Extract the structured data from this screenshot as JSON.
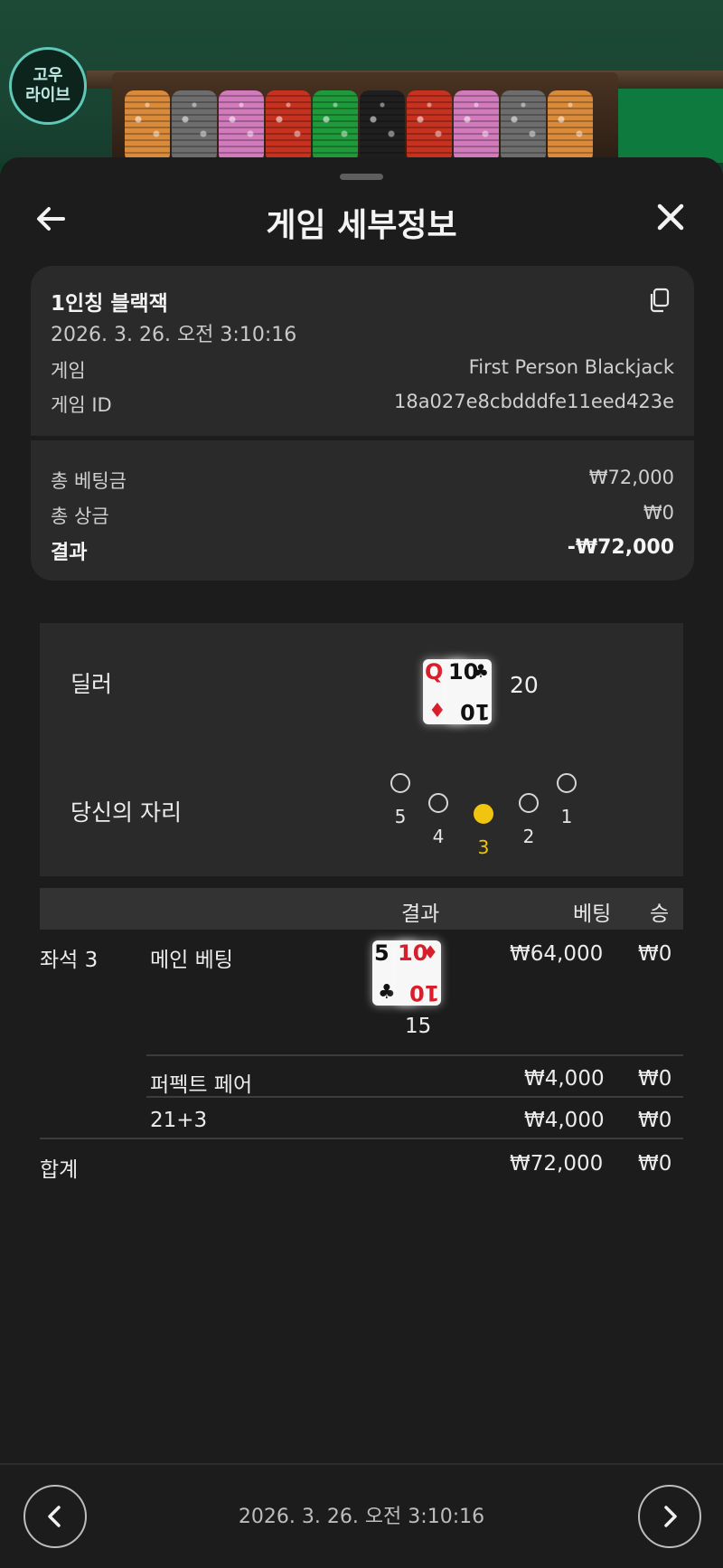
{
  "logo": {
    "line1": "고우",
    "line2": "라이브"
  },
  "header": {
    "title": "게임 세부정보",
    "back_icon": "arrow-left-icon",
    "close_icon": "close-icon"
  },
  "summary": {
    "game_name": "1인칭 블랙잭",
    "datetime": "2026. 3. 26. 오전 3:10:16",
    "game_label": "게임",
    "game_value": "First Person Blackjack",
    "game_id_label": "게임 ID",
    "game_id_value": "18a027e8cbdddfe11eed423e",
    "total_bet_label": "총 베팅금",
    "total_bet_value": "₩72,000",
    "total_prize_label": "총 상금",
    "total_prize_value": "₩0",
    "result_label": "결과",
    "result_value": "-₩72,000"
  },
  "dealer": {
    "label": "딜러",
    "cards": [
      {
        "rank": "Q",
        "suit": "♦"
      },
      {
        "rank": "10",
        "suit": "♣"
      }
    ],
    "total": "20"
  },
  "seats": {
    "label": "당신의 자리",
    "positions": [
      {
        "number": "5",
        "active": false
      },
      {
        "number": "4",
        "active": false
      },
      {
        "number": "3",
        "active": true
      },
      {
        "number": "2",
        "active": false
      },
      {
        "number": "1",
        "active": false
      }
    ]
  },
  "results_table": {
    "headers": {
      "result": "결과",
      "bet": "베팅",
      "win": "승"
    },
    "seat_label": "좌석 3",
    "rows": [
      {
        "name": "메인 베팅",
        "cards": [
          {
            "rank": "5",
            "suit": "♣"
          },
          {
            "rank": "10",
            "suit": "♦"
          }
        ],
        "hand_total": "15",
        "bet": "₩64,000",
        "win": "₩0"
      },
      {
        "name": "퍼펙트 페어",
        "bet": "₩4,000",
        "win": "₩0"
      },
      {
        "name": "21+3",
        "bet": "₩4,000",
        "win": "₩0"
      }
    ],
    "total_label": "합계",
    "total_bet": "₩72,000",
    "total_win": "₩0"
  },
  "footer": {
    "datetime": "2026. 3. 26. 오전 3:10:16",
    "prev_icon": "chevron-left-icon",
    "next_icon": "chevron-right-icon"
  },
  "colors": {
    "sheet_bg": "#1c1c1c",
    "card_bg": "#2a2a2a",
    "active_seat": "#f1c40f",
    "card_red": "#d81e2a"
  }
}
